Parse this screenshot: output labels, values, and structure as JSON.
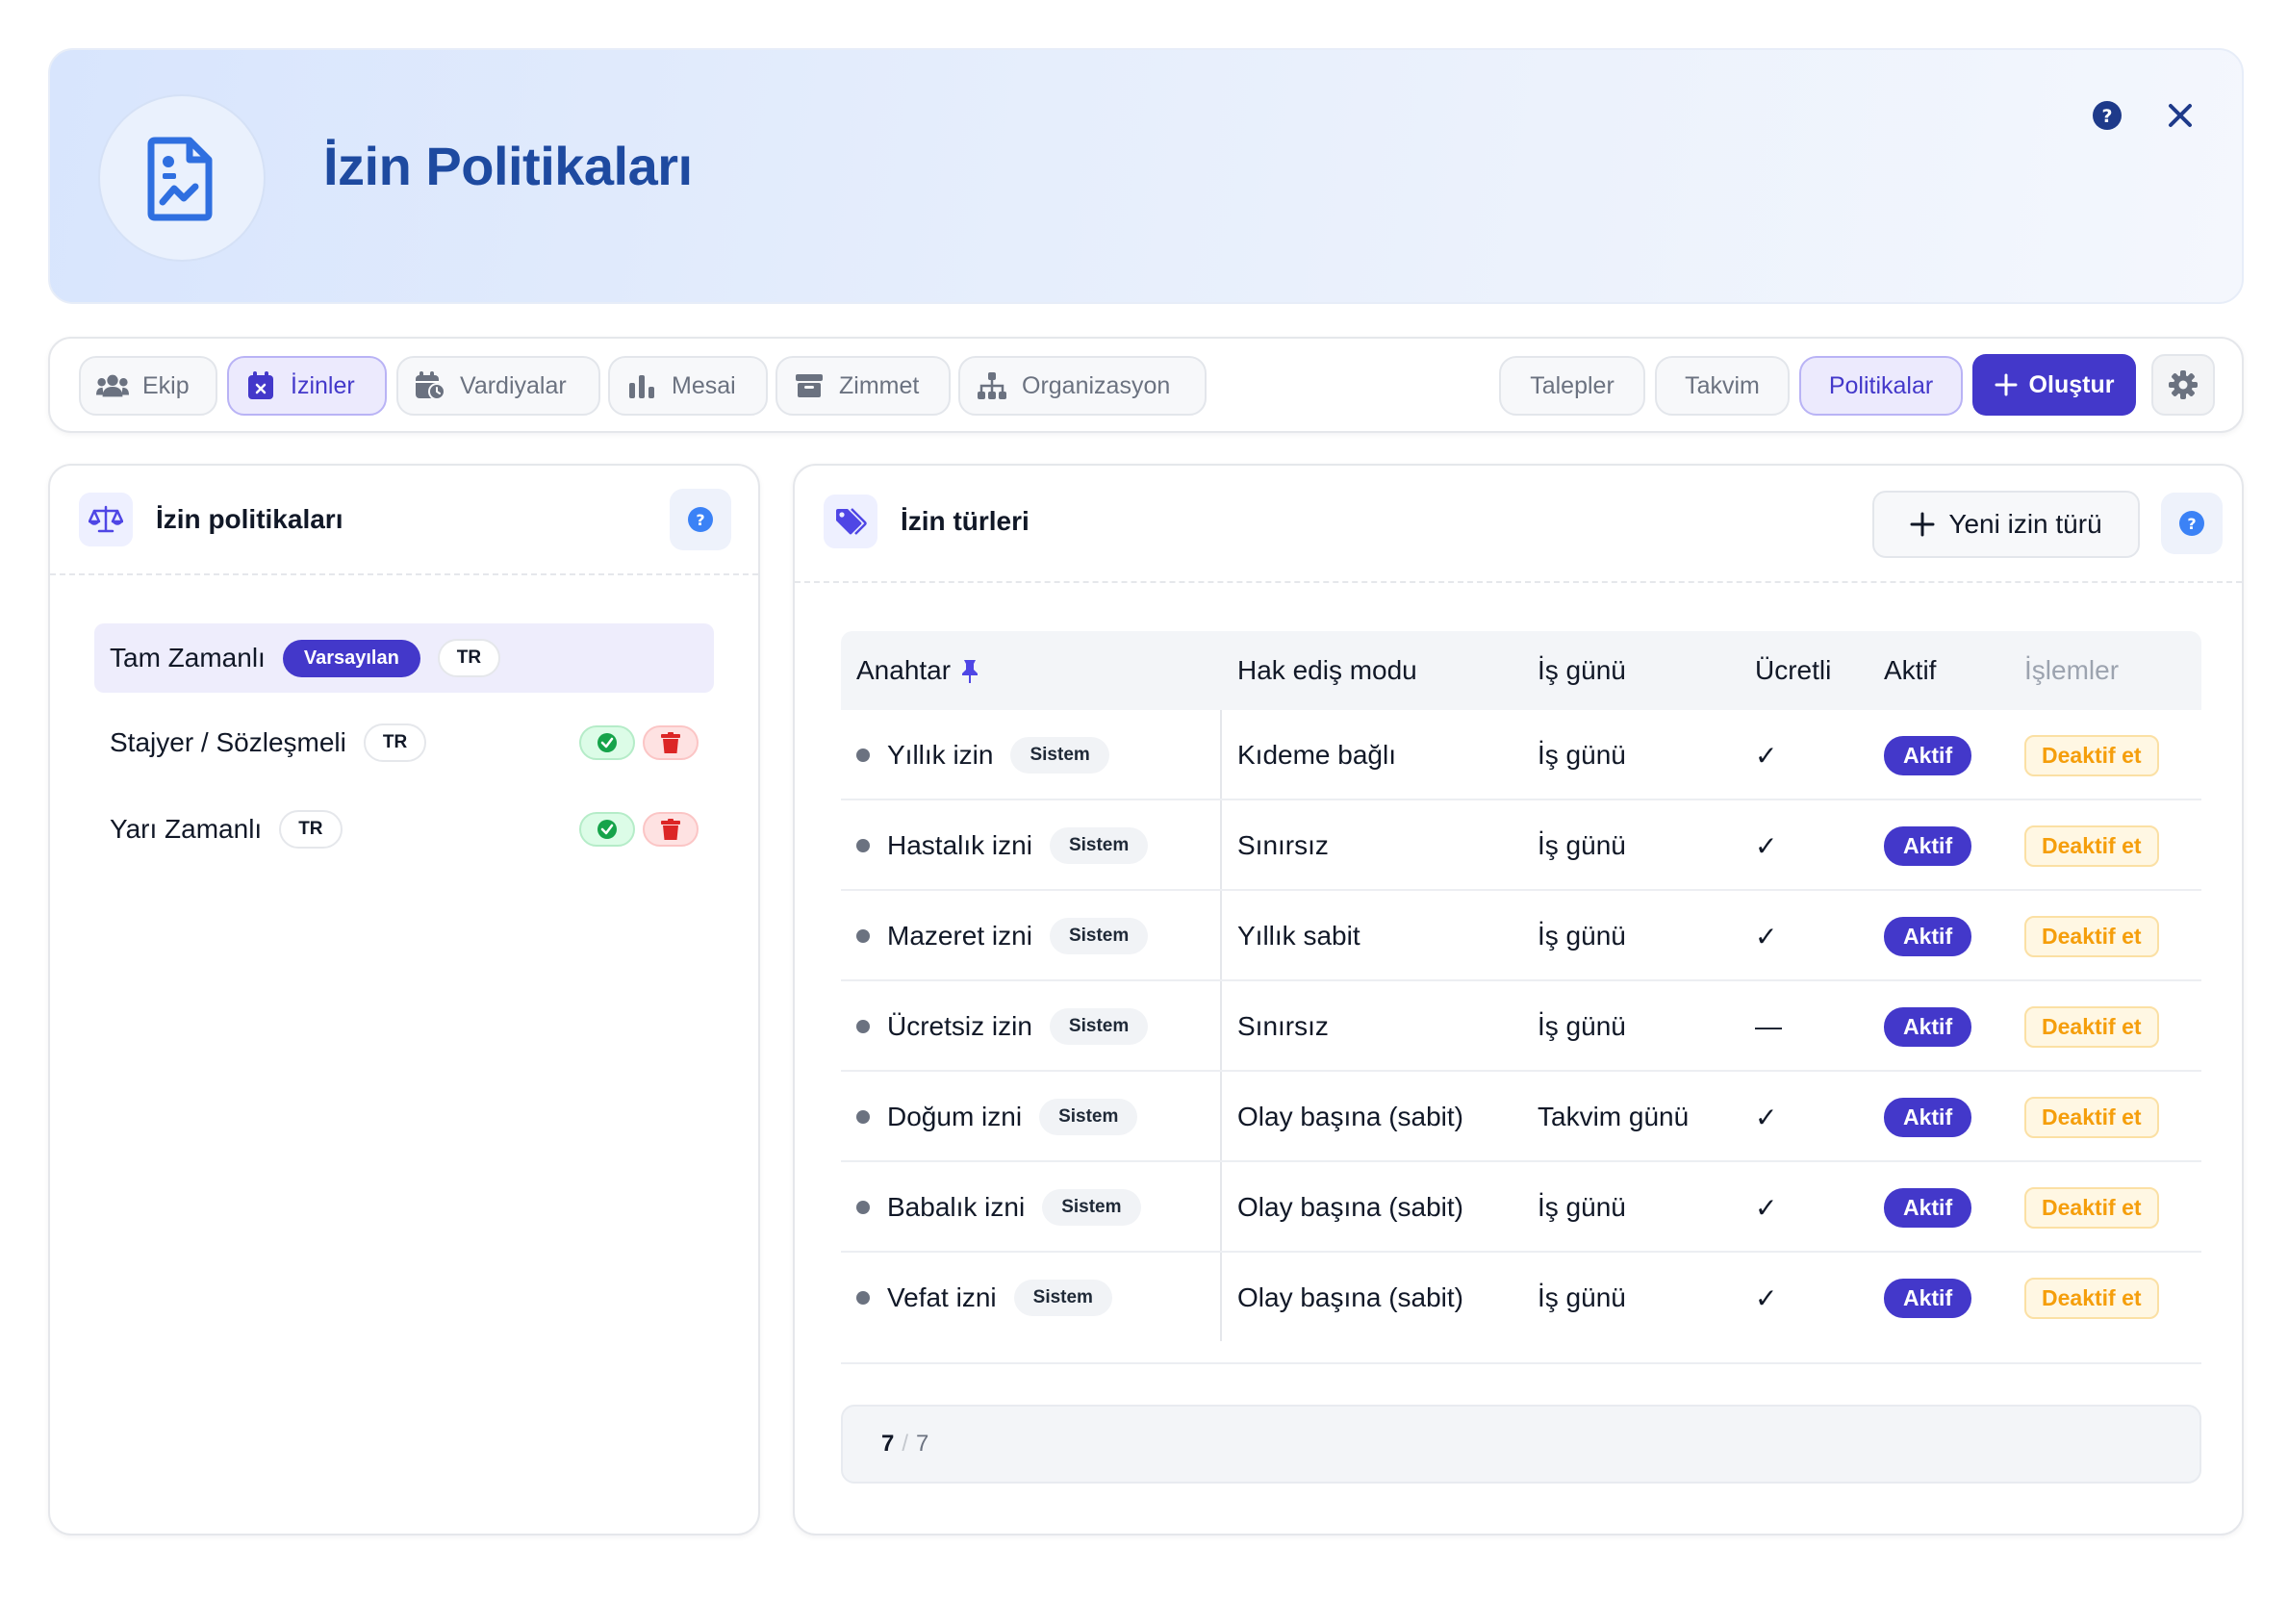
{
  "header": {
    "title": "İzin Politikaları",
    "icon": "document-chart-icon",
    "help_icon": "help-icon",
    "close_icon": "close-icon"
  },
  "nav": {
    "tabs": [
      {
        "label": "Ekip",
        "icon": "users-icon",
        "active": false
      },
      {
        "label": "İzinler",
        "icon": "calendar-x-icon",
        "active": true
      },
      {
        "label": "Vardiyalar",
        "icon": "calendar-clock-icon",
        "active": false
      },
      {
        "label": "Mesai",
        "icon": "bar-chart-icon",
        "active": false
      },
      {
        "label": "Zimmet",
        "icon": "archive-icon",
        "active": false
      },
      {
        "label": "Organizasyon",
        "icon": "org-chart-icon",
        "active": false
      }
    ],
    "subtabs": [
      {
        "label": "Talepler",
        "active": false
      },
      {
        "label": "Takvim",
        "active": false
      },
      {
        "label": "Politikalar",
        "active": true
      }
    ],
    "create_label": "Oluştur"
  },
  "policies_panel": {
    "title": "İzin politikaları",
    "items": [
      {
        "name": "Tam Zamanlı",
        "default_badge": "Varsayılan",
        "lang": "TR",
        "selected": true
      },
      {
        "name": "Stajyer / Sözleşmeli",
        "lang": "TR",
        "selected": false
      },
      {
        "name": "Yarı Zamanlı",
        "lang": "TR",
        "selected": false
      }
    ]
  },
  "types_panel": {
    "title": "İzin türleri",
    "new_button": "Yeni izin türü",
    "columns": [
      "Anahtar",
      "Hak ediş modu",
      "İş günü",
      "Ücretli",
      "Aktif",
      "İşlemler"
    ],
    "rows": [
      {
        "key": "Yıllık izin",
        "tag": "Sistem",
        "mode": "Kıdeme bağlı",
        "day_type": "İş günü",
        "paid": "✓",
        "status": "Aktif",
        "action": "Deaktif et"
      },
      {
        "key": "Hastalık izni",
        "tag": "Sistem",
        "mode": "Sınırsız",
        "day_type": "İş günü",
        "paid": "✓",
        "status": "Aktif",
        "action": "Deaktif et"
      },
      {
        "key": "Mazeret izni",
        "tag": "Sistem",
        "mode": "Yıllık sabit",
        "day_type": "İş günü",
        "paid": "✓",
        "status": "Aktif",
        "action": "Deaktif et"
      },
      {
        "key": "Ücretsiz izin",
        "tag": "Sistem",
        "mode": "Sınırsız",
        "day_type": "İş günü",
        "paid": "—",
        "status": "Aktif",
        "action": "Deaktif et"
      },
      {
        "key": "Doğum izni",
        "tag": "Sistem",
        "mode": "Olay başına (sabit)",
        "day_type": "Takvim günü",
        "paid": "✓",
        "status": "Aktif",
        "action": "Deaktif et"
      },
      {
        "key": "Babalık izni",
        "tag": "Sistem",
        "mode": "Olay başına (sabit)",
        "day_type": "İş günü",
        "paid": "✓",
        "status": "Aktif",
        "action": "Deaktif et"
      },
      {
        "key": "Vefat izni",
        "tag": "Sistem",
        "mode": "Olay başına (sabit)",
        "day_type": "İş günü",
        "paid": "✓",
        "status": "Aktif",
        "action": "Deaktif et"
      }
    ],
    "pager": {
      "current": "7",
      "separator": "/",
      "total": "7"
    }
  },
  "colors": {
    "accent": "#4338ca",
    "title_blue": "#1e4aa0",
    "warning": "#f59e0b"
  }
}
